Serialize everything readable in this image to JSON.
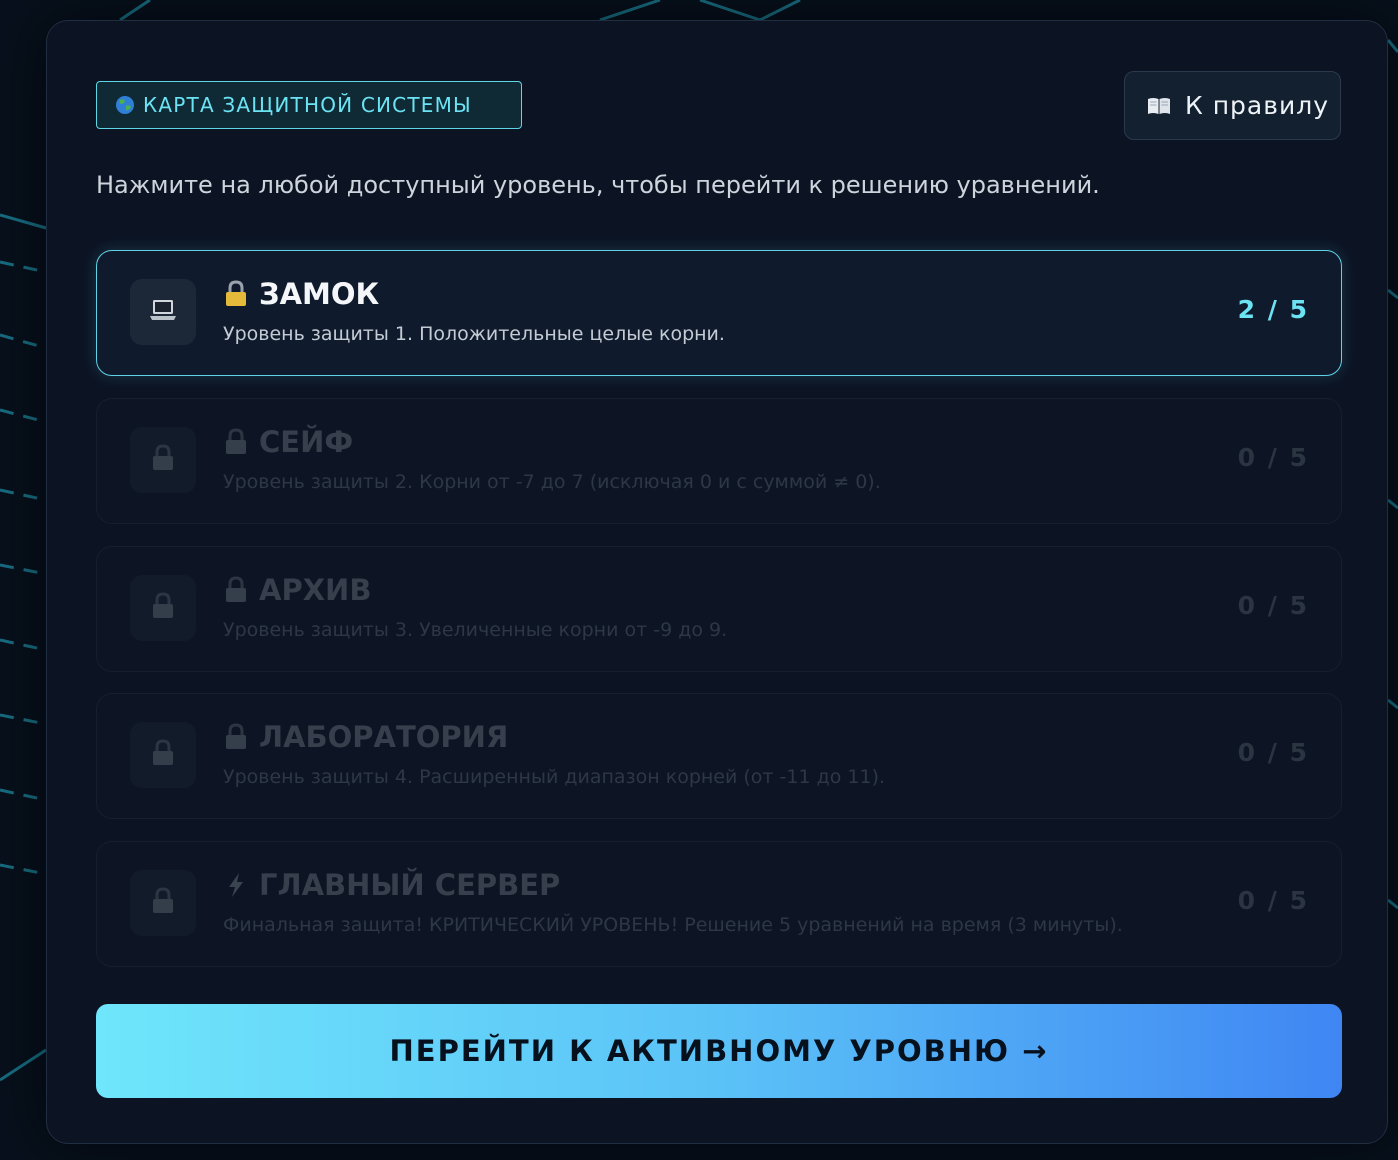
{
  "header": {
    "map_badge_label": "КАРТА ЗАЩИТНОЙ СИСТЕМЫ",
    "map_badge_icon": "globe-icon",
    "rules_button_label": "К правилу",
    "rules_button_icon": "book-icon"
  },
  "instructions": "Нажмите на любой доступный уровень, чтобы перейти к решению уравнений.",
  "levels": [
    {
      "title": "ЗАМОК",
      "title_icon": "lock-icon",
      "description": "Уровень защиты 1. Положительные целые корни.",
      "progress": "2 / 5",
      "status": "active",
      "side_icon": "laptop-icon"
    },
    {
      "title": "СЕЙФ",
      "title_icon": "lock-icon",
      "description": "Уровень защиты 2. Корни от -7 до 7 (исключая 0 и с суммой ≠ 0).",
      "progress": "0 / 5",
      "status": "locked",
      "side_icon": "lock-icon"
    },
    {
      "title": "АРХИВ",
      "title_icon": "lock-icon",
      "description": "Уровень защиты 3. Увеличенные корни от -9 до 9.",
      "progress": "0 / 5",
      "status": "locked",
      "side_icon": "lock-icon"
    },
    {
      "title": "ЛАБОРАТОРИЯ",
      "title_icon": "lock-icon",
      "description": "Уровень защиты 4. Расширенный диапазон корней (от -11 до 11).",
      "progress": "0 / 5",
      "status": "locked",
      "side_icon": "lock-icon"
    },
    {
      "title": "ГЛАВНЫЙ СЕРВЕР",
      "title_icon": "lightning-icon",
      "description": "Финальная защита! КРИТИЧЕСКИЙ УРОВЕНЬ! Решение 5 уравнений на время (3 минуты).",
      "progress": "0 / 5",
      "status": "locked",
      "side_icon": "lock-icon"
    }
  ],
  "go_button_label": "ПЕРЕЙТИ К АКТИВНОМУ УРОВНЮ →",
  "colors": {
    "accent": "#6be3f3",
    "background": "#07101c",
    "panel": "#0c1424",
    "button_gradient_start": "#6fe6fb",
    "button_gradient_end": "#3f86f3"
  }
}
